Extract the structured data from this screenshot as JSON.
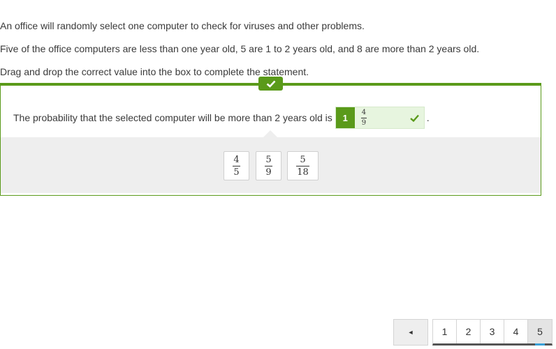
{
  "question": {
    "paragraphs": [
      "An office will randomly select one computer to check for viruses and other problems.",
      "Five of the office computers are less than one year old, 5 are 1 to 2 years old, and 8 are more than 2 years old.",
      "Drag and drop the correct value into the box to complete the statement."
    ],
    "statement": "The probability that the selected computer will be more than 2 years old is",
    "statement_end": ".",
    "dropzone": {
      "index": "1",
      "value": {
        "num": "4",
        "den": "9"
      },
      "status_icon": "checkmark-icon"
    },
    "check_tab_icon": "checkmark-icon"
  },
  "tiles": [
    {
      "num": "4",
      "den": "5"
    },
    {
      "num": "5",
      "den": "9"
    },
    {
      "num": "5",
      "den": "18"
    }
  ],
  "pager": {
    "prev_label": "◄",
    "pages": [
      "1",
      "2",
      "3",
      "4",
      "5"
    ],
    "current_page": "5"
  },
  "colors": {
    "accent": "#5a9a1a",
    "correct_bg": "#e7f5df",
    "tray_bg": "#eeeeee",
    "page_indicator": "#3aa0d8"
  }
}
